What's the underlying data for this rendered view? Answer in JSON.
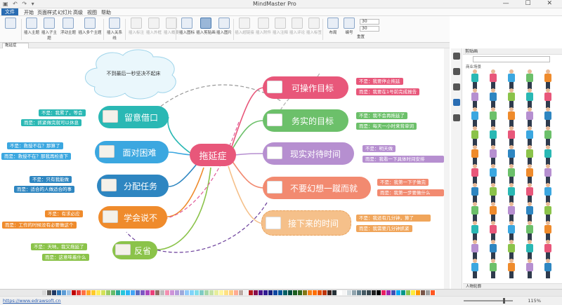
{
  "app": {
    "title": "MindMaster Pro",
    "quick_access": "▣ ↶ ↷ ▾"
  },
  "window_buttons": "— ☐ ✕",
  "menus": [
    "文件",
    "开始",
    "页面样式",
    "幻灯片",
    "高级",
    "视图",
    "帮助"
  ],
  "ribbon": {
    "buttons": [
      "插入主题",
      "插入子主题",
      "浮动主题",
      "插入多个主题",
      "插入关系线",
      "插入标注",
      "插入外框",
      "插入概要",
      "插入图标",
      "插入剪贴画",
      "插入图片",
      "插入超链接",
      "插入附件",
      "插入注释",
      "插入评论",
      "插入标签",
      "布局",
      "编号",
      "重置"
    ],
    "spin_values": [
      "30",
      "30"
    ]
  },
  "document_tab": "拖延症",
  "clipart": {
    "header": "剪贴画",
    "category": "商业场景",
    "footer": "人物轮廓"
  },
  "status": {
    "url": "https://www.edrawsoft.cn",
    "zoom": "115%"
  },
  "palette_colors": [
    "#d9d9d9",
    "#595959",
    "#1f3864",
    "#2e75b6",
    "#5b9bd5",
    "#9dc3e6",
    "#c00000",
    "#e53935",
    "#ff7043",
    "#ffa726",
    "#ffca28",
    "#ffee58",
    "#d4e157",
    "#9ccc65",
    "#66bb6a",
    "#26a69a",
    "#26c6da",
    "#29b6f6",
    "#42a5f5",
    "#5c6bc0",
    "#7e57c2",
    "#ab47bc",
    "#ec407a",
    "#8d6e63",
    "#bdbdbd",
    "#f48fb1",
    "#ce93d8",
    "#b39ddb",
    "#9fa8da",
    "#90caf9",
    "#81d4fa",
    "#80deea",
    "#80cbc4",
    "#a5d6a7",
    "#c5e1a5",
    "#e6ee9c",
    "#fff59d",
    "#ffe082",
    "#ffcc80",
    "#ffab91",
    "#bcaaa4",
    "#eeeeee",
    "#b71c1c",
    "#880e4f",
    "#4a148c",
    "#311b92",
    "#1a237e",
    "#0d47a1",
    "#01579b",
    "#006064",
    "#004d40",
    "#1b5e20",
    "#33691e",
    "#827717",
    "#f57f17",
    "#ff6f00",
    "#e65100",
    "#bf360c",
    "#3e2723",
    "#263238",
    "#ffffff",
    "#f5f5f5",
    "#cfd8dc",
    "#90a4ae",
    "#607d8b",
    "#455a64",
    "#37474f",
    "#212121",
    "#000000",
    "#e91e63",
    "#9c27b0",
    "#3f51b5",
    "#03a9f4",
    "#009688",
    "#8bc34a",
    "#ffeb3b",
    "#ff9800",
    "#795548",
    "#9e9e9e",
    "#ff5722"
  ],
  "mindmap": {
    "center": {
      "label": "拖延症",
      "color": "#e8577a"
    },
    "cloud": "不到最后一秒坚决不起床",
    "left": [
      {
        "label": "留意借口",
        "color": "#2ab8b4",
        "notes": [
          "不是：我累了，等会",
          "而是：抓紧做完就可以休息"
        ],
        "note_color": "#2ab8b4"
      },
      {
        "label": "面对困难",
        "color": "#3ba7e0",
        "notes": [
          "不是：救授不在？那算了",
          "而是：救授不在？那我再检查下"
        ],
        "note_color": "#3ba7e0"
      },
      {
        "label": "分配任务",
        "color": "#2e86c1",
        "notes": [
          "不是：只有我能做",
          "而是：适合的人做适合的事"
        ],
        "note_color": "#2e86c1"
      },
      {
        "label": "学会说不",
        "color": "#ef8b2c",
        "notes": [
          "不是：有求必应",
          "而是：工作的时候没有必要做这个"
        ],
        "note_color": "#ef8b2c"
      },
      {
        "label": "反省",
        "color": "#8bc34a",
        "notes": [
          "不是：天呐，我又拖延了",
          "而是：这意味着什么"
        ],
        "note_color": "#8bc34a"
      }
    ],
    "right": [
      {
        "label": "可操作目标",
        "color": "#e8577a",
        "notes": [
          "不是：我要停止拖延",
          "而是：我要在1号前完成报告"
        ],
        "note_color": "#e8577a"
      },
      {
        "label": "务实的目标",
        "color": "#6cc06a",
        "notes": [
          "不是：我不会再拖延了",
          "而是：每天一小时来背单词"
        ],
        "note_color": "#6cc06a"
      },
      {
        "label": "现实对待时间",
        "color": "#b68fd0",
        "notes": [
          "不是：明天做",
          "而是：我看一下具体时间安排"
        ],
        "note_color": "#b68fd0"
      },
      {
        "label": "不要幻想一蹴而就",
        "color": "#f28a70",
        "notes": [
          "不是：我第一下子做完",
          "而是：我第一步要做什么"
        ],
        "note_color": "#f28a70"
      },
      {
        "label": "接下来的时间",
        "color": "#f5c08a",
        "notes": [
          "不是：我还有几分钟，算了",
          "而是：我需要几分钟抓紧"
        ],
        "note_color": "#f0a55a"
      }
    ]
  }
}
